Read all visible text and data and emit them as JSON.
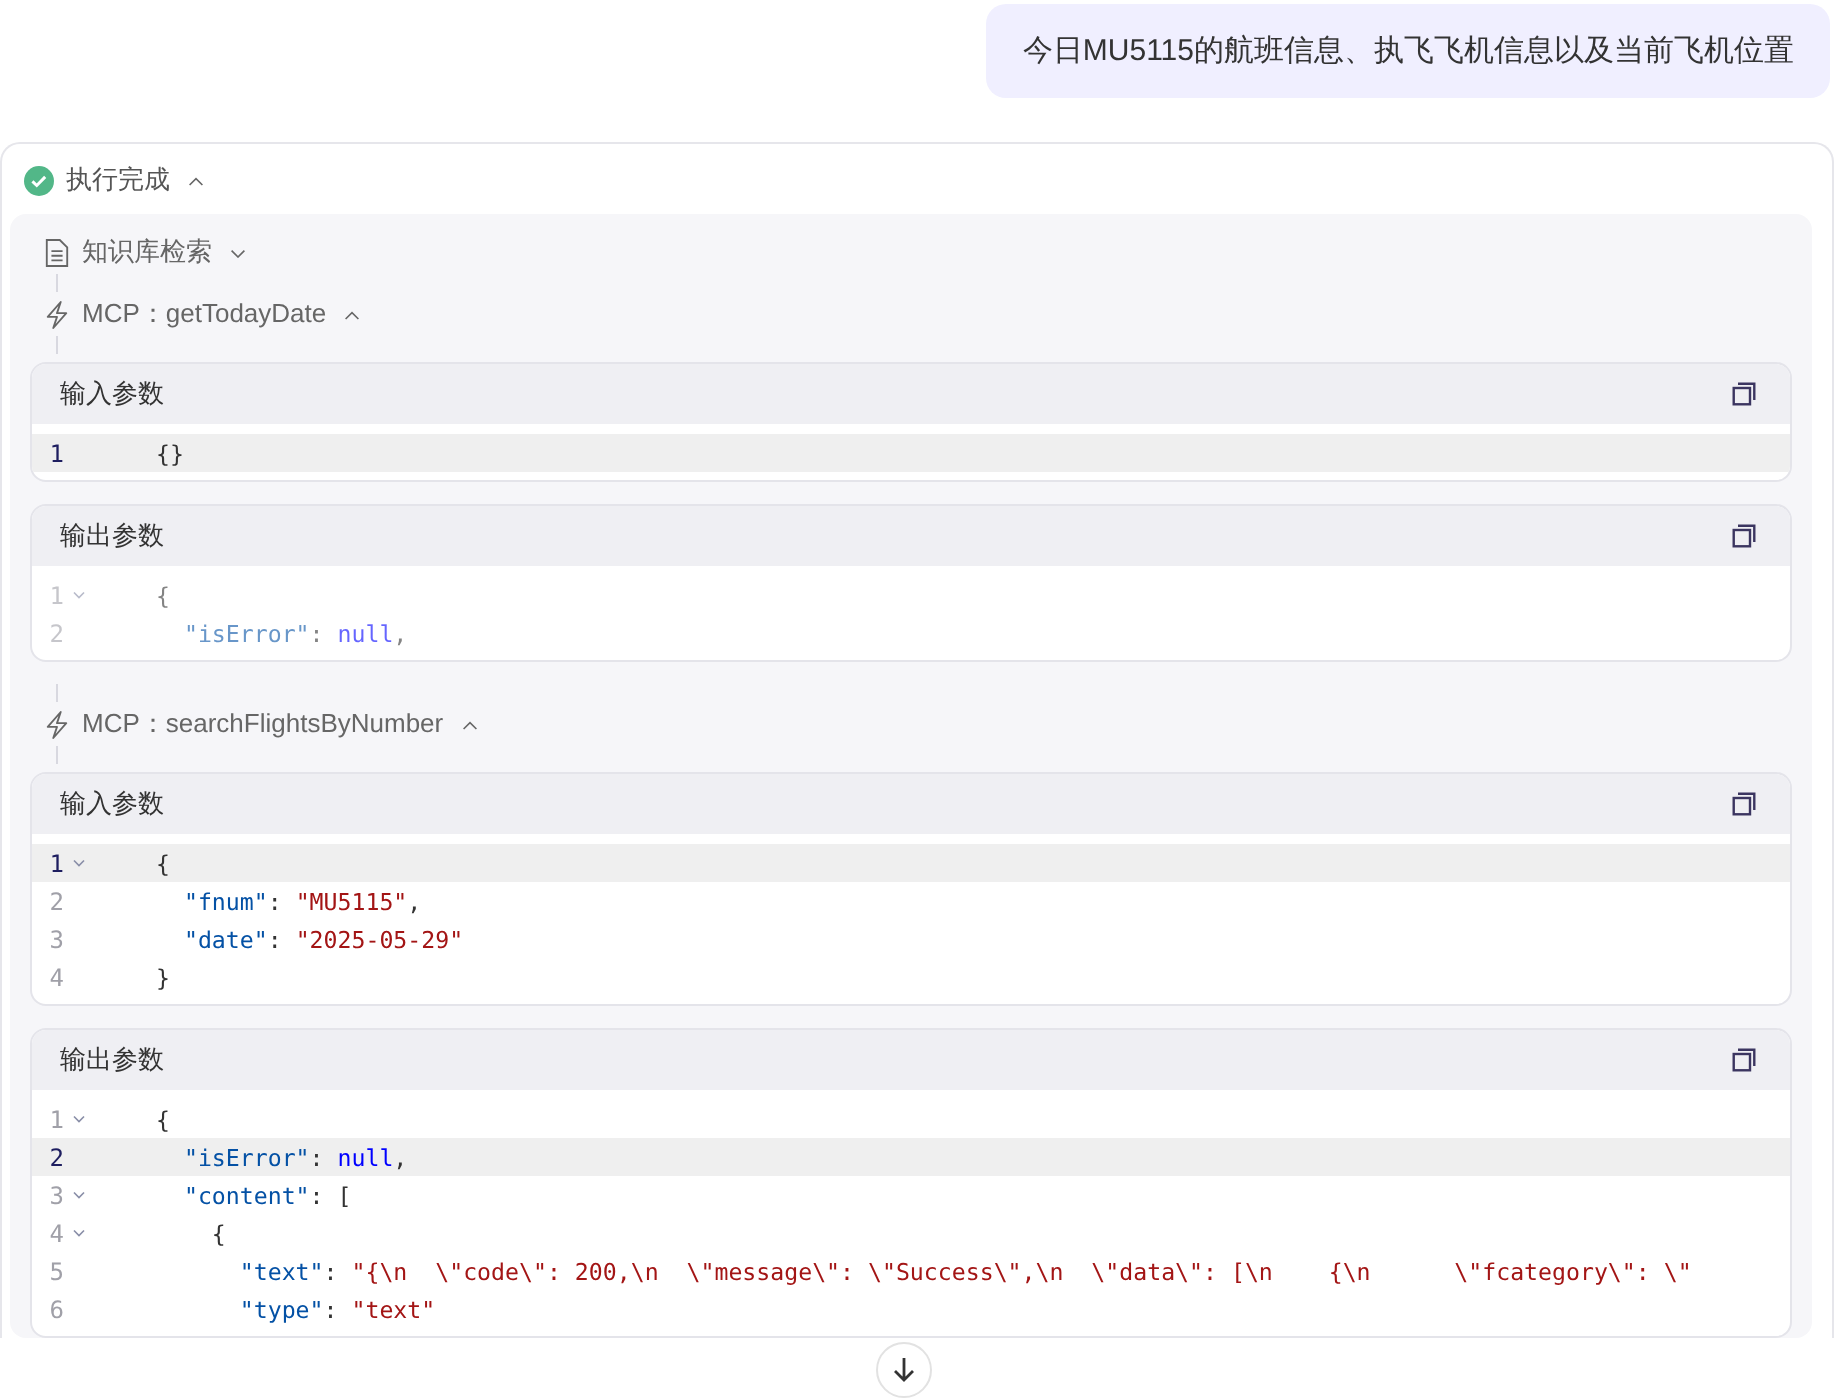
{
  "user_message": "今日MU5115的航班信息、执飞飞机信息以及当前飞机位置",
  "run_status": {
    "label": "执行完成",
    "expanded": true
  },
  "steps": [
    {
      "kind": "knowledge",
      "label": "知识库检索",
      "expanded": false
    },
    {
      "kind": "mcp",
      "label": "MCP：getTodayDate",
      "expanded": true,
      "panels": [
        {
          "title": "输入参数",
          "faded": false,
          "lines": [
            {
              "number": "1",
              "foldable": false,
              "active": true,
              "tokens": [
                {
                  "kind": "punct",
                  "text": "{}"
                }
              ]
            }
          ]
        },
        {
          "title": "输出参数",
          "faded": true,
          "lines": [
            {
              "number": "1",
              "foldable": true,
              "active": false,
              "tokens": [
                {
                  "kind": "punct",
                  "text": "{"
                }
              ]
            },
            {
              "number": "2",
              "foldable": false,
              "active": false,
              "tokens": [
                {
                  "kind": "key",
                  "text": "  \"isError\""
                },
                {
                  "kind": "punct",
                  "text": ": "
                },
                {
                  "kind": "keyword",
                  "text": "null"
                },
                {
                  "kind": "punct",
                  "text": ","
                }
              ]
            }
          ]
        }
      ]
    },
    {
      "kind": "mcp",
      "label": "MCP：searchFlightsByNumber",
      "expanded": true,
      "panels": [
        {
          "title": "输入参数",
          "faded": false,
          "lines": [
            {
              "number": "1",
              "foldable": true,
              "active": true,
              "tokens": [
                {
                  "kind": "punct",
                  "text": "{"
                }
              ]
            },
            {
              "number": "2",
              "foldable": false,
              "active": false,
              "tokens": [
                {
                  "kind": "key",
                  "text": "  \"fnum\""
                },
                {
                  "kind": "punct",
                  "text": ": "
                },
                {
                  "kind": "string",
                  "text": "\"MU5115\""
                },
                {
                  "kind": "punct",
                  "text": ","
                }
              ]
            },
            {
              "number": "3",
              "foldable": false,
              "active": false,
              "tokens": [
                {
                  "kind": "key",
                  "text": "  \"date\""
                },
                {
                  "kind": "punct",
                  "text": ": "
                },
                {
                  "kind": "string",
                  "text": "\"2025-05-29\""
                }
              ]
            },
            {
              "number": "4",
              "foldable": false,
              "active": false,
              "tokens": [
                {
                  "kind": "punct",
                  "text": "}"
                }
              ]
            }
          ]
        },
        {
          "title": "输出参数",
          "faded": false,
          "lines": [
            {
              "number": "1",
              "foldable": true,
              "active": false,
              "tokens": [
                {
                  "kind": "punct",
                  "text": "{"
                }
              ]
            },
            {
              "number": "2",
              "foldable": false,
              "active": true,
              "tokens": [
                {
                  "kind": "key",
                  "text": "  \"isError\""
                },
                {
                  "kind": "punct",
                  "text": ": "
                },
                {
                  "kind": "keyword",
                  "text": "null"
                },
                {
                  "kind": "punct",
                  "text": ","
                }
              ]
            },
            {
              "number": "3",
              "foldable": true,
              "active": false,
              "tokens": [
                {
                  "kind": "key",
                  "text": "  \"content\""
                },
                {
                  "kind": "punct",
                  "text": ": ["
                }
              ]
            },
            {
              "number": "4",
              "foldable": true,
              "active": false,
              "tokens": [
                {
                  "kind": "punct",
                  "text": "    {"
                }
              ]
            },
            {
              "number": "5",
              "foldable": false,
              "active": false,
              "tokens": [
                {
                  "kind": "key",
                  "text": "      \"text\""
                },
                {
                  "kind": "punct",
                  "text": ": "
                },
                {
                  "kind": "string",
                  "text": "\"{\\n  \\\"code\\\": 200,\\n  \\\"message\\\": \\\"Success\\\",\\n  \\\"data\\\": [\\n    {\\n      \\\"fcategory\\\": \\\""
                }
              ]
            },
            {
              "number": "6",
              "foldable": false,
              "active": false,
              "tokens": [
                {
                  "kind": "key",
                  "text": "      \"type\""
                },
                {
                  "kind": "punct",
                  "text": ": "
                },
                {
                  "kind": "string",
                  "text": "\"text\""
                }
              ]
            }
          ]
        }
      ]
    }
  ]
}
